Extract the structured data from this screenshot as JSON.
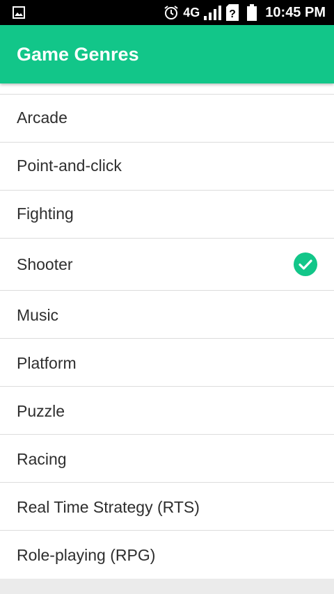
{
  "status_bar": {
    "network": "4G",
    "time": "10:45 PM",
    "icons": [
      "image-notification-icon",
      "alarm-icon",
      "signal-icon",
      "unknown-sim-icon",
      "battery-icon"
    ]
  },
  "app_bar": {
    "title": "Game Genres"
  },
  "genres": [
    {
      "label": "Arcade",
      "selected": false
    },
    {
      "label": "Point-and-click",
      "selected": false
    },
    {
      "label": "Fighting",
      "selected": false
    },
    {
      "label": "Shooter",
      "selected": true
    },
    {
      "label": "Music",
      "selected": false
    },
    {
      "label": "Platform",
      "selected": false
    },
    {
      "label": "Puzzle",
      "selected": false
    },
    {
      "label": "Racing",
      "selected": false
    },
    {
      "label": "Real Time Strategy (RTS)",
      "selected": false
    },
    {
      "label": "Role-playing (RPG)",
      "selected": false
    }
  ],
  "colors": {
    "accent": "#12c689",
    "status_bar": "#000000",
    "divider": "#dcdcdc"
  }
}
